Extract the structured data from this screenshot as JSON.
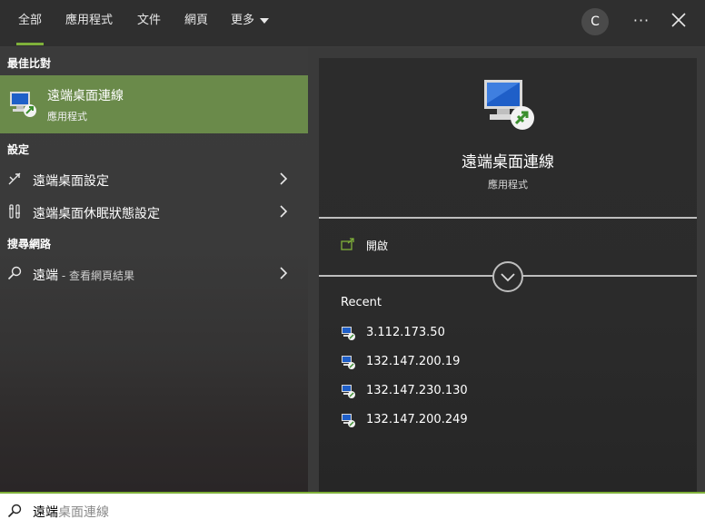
{
  "tabs": [
    {
      "label": "全部",
      "active": true
    },
    {
      "label": "應用程式"
    },
    {
      "label": "文件"
    },
    {
      "label": "網頁"
    },
    {
      "label": "更多"
    }
  ],
  "account_initial": "C",
  "more_options": "···",
  "left": {
    "best_match_heading": "最佳比對",
    "best_match": {
      "title": "遠端桌面連線",
      "subtitle": "應用程式",
      "icon": "remote-desktop-icon"
    },
    "settings_heading": "設定",
    "settings_items": [
      {
        "label": "遠端桌面設定",
        "icon": "remote-settings-icon"
      },
      {
        "label": "遠端桌面休眠狀態設定",
        "icon": "sleep-settings-icon"
      }
    ],
    "web_heading": "搜尋網路",
    "web_item": {
      "query": "遠端",
      "suffix": " - 查看網頁結果",
      "icon": "search-icon"
    }
  },
  "right": {
    "app_title": "遠端桌面連線",
    "app_subtitle": "應用程式",
    "open_label": "開啟",
    "recent_heading": "Recent",
    "recent_items": [
      "3.112.173.50",
      "132.147.200.19",
      "132.147.230.130",
      "132.147.200.249"
    ]
  },
  "search": {
    "typed": "遠端",
    "suggestion": "桌面連線"
  },
  "colors": {
    "accent": "#7fb03a",
    "best_match_bg": "#6a8a4a",
    "panel_bg": "#2c2c2c"
  }
}
